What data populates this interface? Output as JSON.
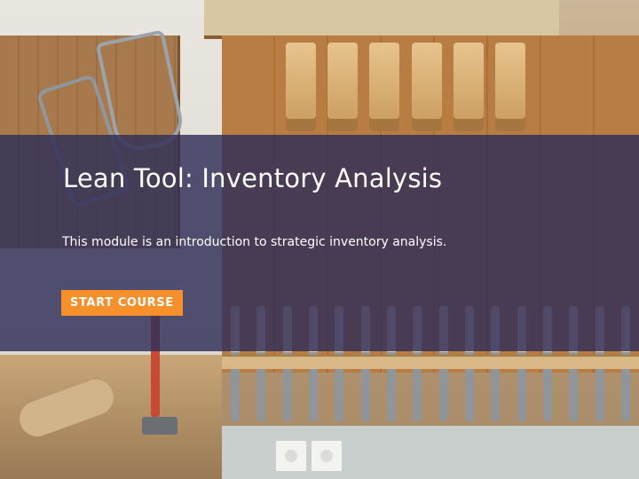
{
  "course": {
    "title": "Lean Tool: Inventory Analysis",
    "description": "This module is an introduction to strategic inventory analysis.",
    "start_label": "START COURSE"
  },
  "colors": {
    "overlay": "#2f2e58",
    "button": "#f7902a",
    "text": "#ffffff"
  }
}
